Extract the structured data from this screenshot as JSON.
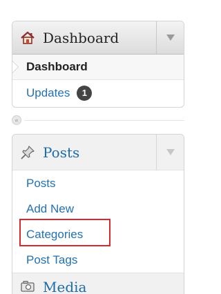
{
  "dashboard_menu": {
    "title": "Dashboard",
    "items": [
      {
        "label": "Dashboard",
        "current": true
      },
      {
        "label": "Updates",
        "badge": "1"
      }
    ]
  },
  "collapse": {
    "glyph": "«"
  },
  "posts_menu": {
    "title": "Posts",
    "items": [
      {
        "label": "Posts"
      },
      {
        "label": "Add New"
      },
      {
        "label": "Categories",
        "highlighted": true
      },
      {
        "label": "Post Tags"
      }
    ]
  },
  "media_menu": {
    "title": "Media"
  },
  "colors": {
    "link": "#2271b1",
    "highlight": "#d9272e",
    "badge": "#444444"
  }
}
